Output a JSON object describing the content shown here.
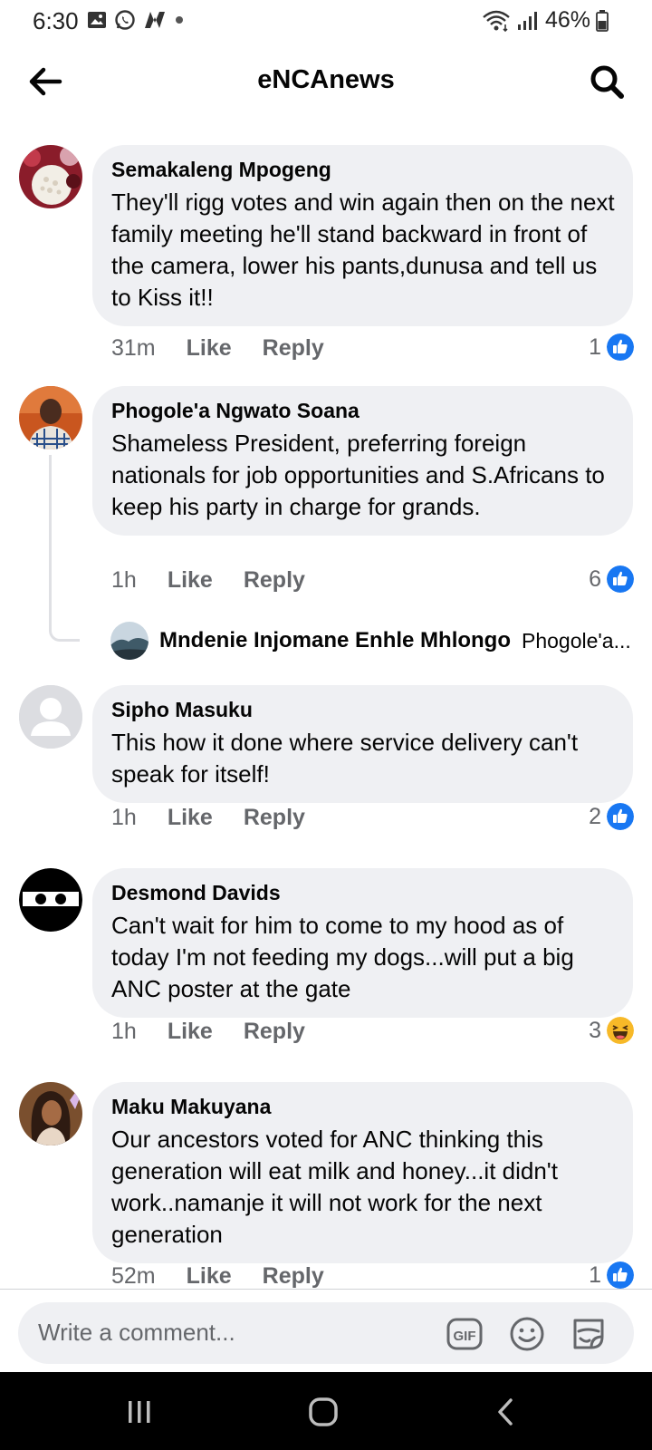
{
  "status_bar": {
    "time": "6:30",
    "battery": "46%"
  },
  "header": {
    "title": "eNCAnews"
  },
  "comments": [
    {
      "author": "Semakaleng Mpogeng",
      "text": "They'll rigg votes and win again then on the next family meeting he'll stand backward in front of the camera, lower his pants,dunusa and tell us to Kiss it!!",
      "time": "31m",
      "like_label": "Like",
      "reply_label": "Reply",
      "reaction_count": "1",
      "reaction_type": "like"
    },
    {
      "author": "Phogole'a Ngwato Soana",
      "text": "Shameless President, preferring foreign nationals for job opportunities and S.Africans to keep his party in charge for grands.",
      "time": "1h",
      "like_label": "Like",
      "reply_label": "Reply",
      "reaction_count": "6",
      "reaction_type": "like",
      "reply_preview": {
        "author": "Mndenie Injomane Enhle Mhlongo",
        "snippet": "Phogole'a..."
      }
    },
    {
      "author": "Sipho Masuku",
      "text": "This how it done where service delivery can't speak for itself!",
      "time": "1h",
      "like_label": "Like",
      "reply_label": "Reply",
      "reaction_count": "2",
      "reaction_type": "like"
    },
    {
      "author": "Desmond Davids",
      "text": "Can't wait for him to come to my hood as of today I'm not feeding my dogs...will put a big ANC poster at the gate",
      "time": "1h",
      "like_label": "Like",
      "reply_label": "Reply",
      "reaction_count": "3",
      "reaction_type": "haha"
    },
    {
      "author": "Maku Makuyana",
      "text": "Our ancestors voted for ANC thinking this generation will eat milk and honey...it didn't work..namanje it will not work for the next generation",
      "time": "52m",
      "like_label": "Like",
      "reply_label": "Reply",
      "reaction_count": "1",
      "reaction_type": "like"
    }
  ],
  "composer": {
    "placeholder": "Write a comment...",
    "gif_label": "GIF"
  },
  "colors": {
    "bubble": "#eff0f3",
    "meta_text": "#65676b",
    "like_blue": "#1877f2",
    "haha_yellow": "#f7b928"
  }
}
